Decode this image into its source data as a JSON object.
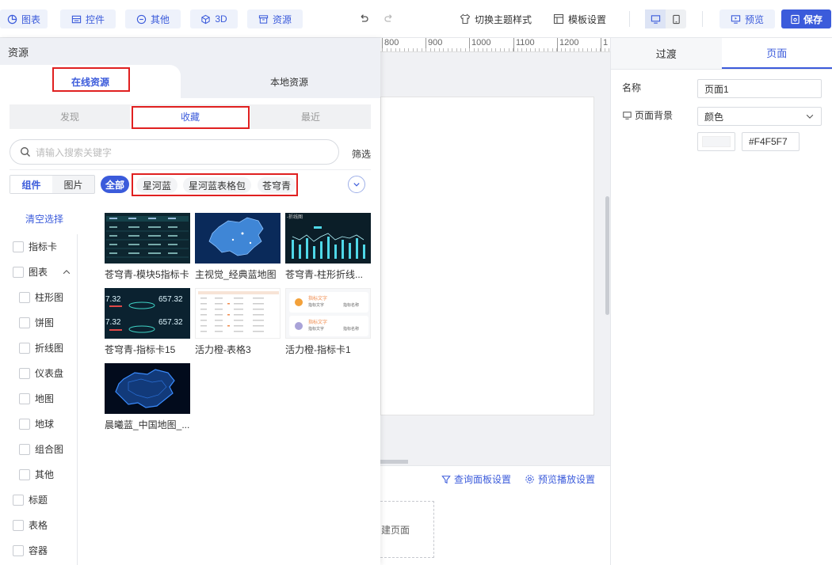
{
  "toolbar": {
    "chart": "图表",
    "control": "控件",
    "other": "其他",
    "three_d": "3D",
    "resource": "资源",
    "switch_theme": "切换主题样式",
    "template_settings": "模板设置",
    "preview": "预览",
    "save": "保存"
  },
  "ruler": {
    "ticks": [
      "800",
      "900",
      "1000",
      "1100",
      "1200",
      "1"
    ]
  },
  "canvas_bottom": {
    "query_panel": "查询面板设置",
    "preview_play": "预览播放设置",
    "new_page": "建页面"
  },
  "right_panel": {
    "tabs": [
      "过渡",
      "页面"
    ],
    "name_label": "名称",
    "name_value": "页面1",
    "bg_label": "页面背景",
    "bg_type": "颜色",
    "bg_color": "#F4F5F7"
  },
  "resource_panel": {
    "title": "资源",
    "top_tabs": [
      "在线资源",
      "本地资源"
    ],
    "sub_tabs": [
      "发现",
      "收藏",
      "最近"
    ],
    "search_placeholder": "请输入搜索关键字",
    "filter": "筛选",
    "seg": [
      "组件",
      "图片"
    ],
    "all": "全部",
    "chips": [
      "星河蓝",
      "星河蓝表格包",
      "苍穹青"
    ],
    "clear": "清空选择",
    "categories": [
      "指标卡",
      "图表",
      "柱形图",
      "饼图",
      "折线图",
      "仪表盘",
      "地图",
      "地球",
      "组合图",
      "其他",
      "标题",
      "表格",
      "容器"
    ],
    "items": [
      "苍穹青-模块5指标卡",
      "主视觉_经典蓝地图",
      "苍穹青-柱形折线...",
      "苍穹青-指标卡15",
      "活力橙-表格3",
      "活力橙-指标卡1",
      "晨曦蓝_中国地图_..."
    ],
    "thumb_text": {
      "kpi_value": "657.32",
      "kpi_value2": "7.32",
      "bar_title": "-折线图",
      "card_title": "指标文字",
      "card_sub": "指标文字",
      "card_note": "指标名称"
    }
  },
  "colors": {
    "accent": "#3b5bdb",
    "highlight": "#e02020"
  }
}
